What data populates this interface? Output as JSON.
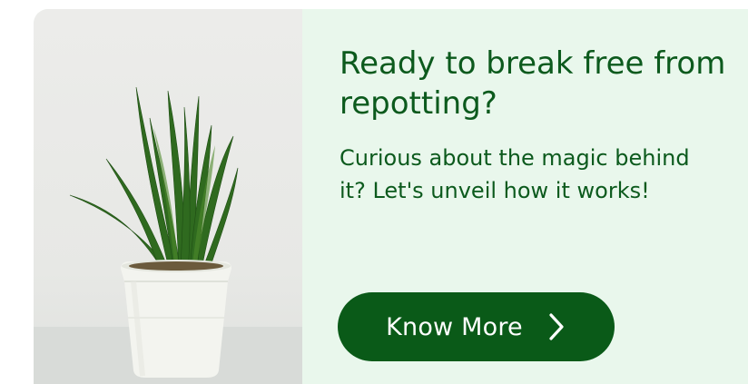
{
  "card": {
    "headline": "Ready to break free from repotting?",
    "subtext": "Curious about the magic behind it? Let's unveil how it works!",
    "cta_label": "Know More",
    "cta_icon": "chevron-right-icon"
  },
  "colors": {
    "background": "#e9f7ec",
    "text": "#0c5a1d",
    "button": "#0a5a18",
    "button_text": "#ffffff"
  }
}
